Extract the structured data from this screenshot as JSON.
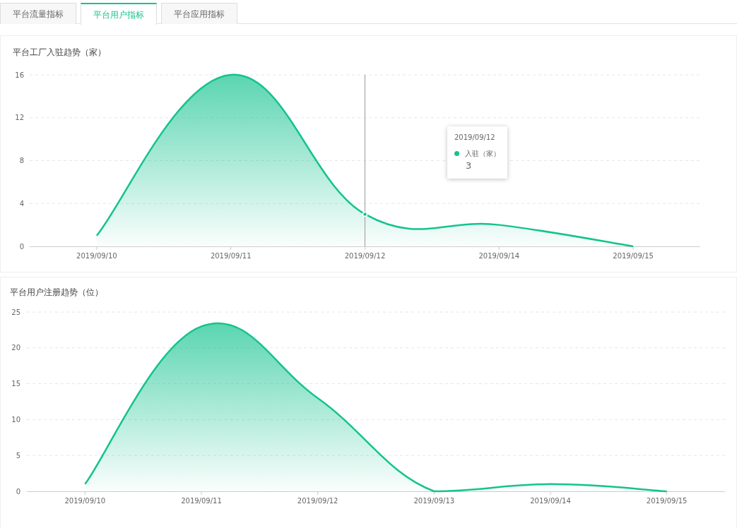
{
  "tabs": [
    {
      "label": "平台流量指标",
      "selected": false
    },
    {
      "label": "平台用户指标",
      "selected": true
    },
    {
      "label": "平台应用指标",
      "selected": false
    }
  ],
  "panels": [
    {
      "title": "平台工厂入驻趋势（家）",
      "chart_data": {
        "type": "area",
        "categories": [
          "2019/09/10",
          "2019/09/11",
          "2019/09/12",
          "2019/09/14",
          "2019/09/15"
        ],
        "series": [
          {
            "color": "#14c38e",
            "values": [
              1,
              16,
              3,
              2,
              0
            ]
          }
        ],
        "ylim": [
          0,
          16
        ],
        "yticks": [
          0,
          4,
          8,
          12,
          16
        ],
        "grid": true,
        "ref_lines": [
          {
            "axis": "x",
            "value": "2019/09/12",
            "color": "#999999"
          }
        ]
      },
      "tooltip": {
        "title": "2019/09/12",
        "series_name": "入驻（家）",
        "color": "#14c38e",
        "value": "3"
      }
    },
    {
      "title": "平台用户注册趋势（位）",
      "chart_data": {
        "type": "area",
        "categories": [
          "2019/09/10",
          "2019/09/11",
          "2019/09/12",
          "2019/09/13",
          "2019/09/14",
          "2019/09/15"
        ],
        "series": [
          {
            "color": "#14c38e",
            "values": [
              1,
              23,
              13,
              0,
              1,
              0
            ]
          }
        ],
        "ylim": [
          0,
          25
        ],
        "yticks": [
          0,
          5,
          10,
          15,
          20,
          25
        ],
        "grid": true
      }
    }
  ]
}
